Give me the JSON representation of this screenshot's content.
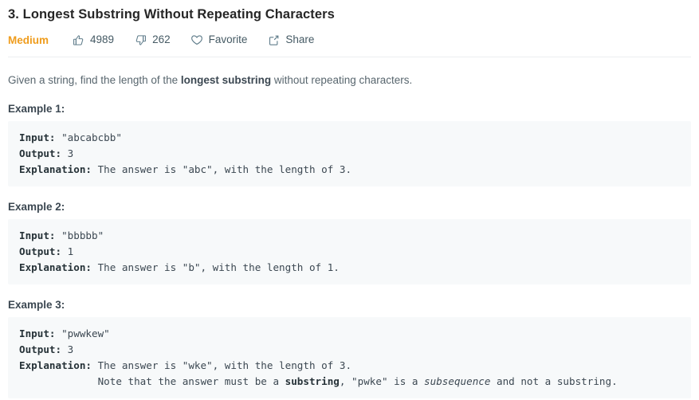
{
  "problem": {
    "title": "3. Longest Substring Without Repeating Characters",
    "difficulty": "Medium",
    "difficulty_color": "#ef9c1c"
  },
  "actions": [
    {
      "name": "likes",
      "icon": "thumbs-up-icon",
      "label": "4989"
    },
    {
      "name": "dislikes",
      "icon": "thumbs-down-icon",
      "label": "262"
    },
    {
      "name": "favorite",
      "icon": "heart-icon",
      "label": "Favorite"
    },
    {
      "name": "share",
      "icon": "share-icon",
      "label": "Share"
    }
  ],
  "description": {
    "lead": "Given a string, find the length of the ",
    "emphasis": "longest substring",
    "trail": " without repeating characters."
  },
  "examples": [
    {
      "heading": "Example 1:",
      "input_label": "Input:",
      "input_value": " \"abcabcbb\"",
      "output_label": "Output:",
      "output_value": " 3",
      "explanation_label": "Explanation:",
      "explanation_value": " The answer is \"abc\", with the length of 3."
    },
    {
      "heading": "Example 2:",
      "input_label": "Input:",
      "input_value": " \"bbbbb\"",
      "output_label": "Output:",
      "output_value": " 1",
      "explanation_label": "Explanation:",
      "explanation_value": " The answer is \"b\", with the length of 1."
    },
    {
      "heading": "Example 3:",
      "input_label": "Input:",
      "input_value": " \"pwwkew\"",
      "output_label": "Output:",
      "output_value": " 3",
      "explanation_label": "Explanation:",
      "explanation_value": " The answer is \"wke\", with the length of 3.",
      "note_indent": "             ",
      "note_part1": "Note that the answer must be a ",
      "note_bold": "substring",
      "note_part2": ", \"pwke\" is a ",
      "note_italic": "subsequence",
      "note_part3": " and not a substring."
    }
  ],
  "theme": {
    "code_background": "#f7f9fa",
    "divider": "#eceff1",
    "text": "#3c4852",
    "muted_text": "#58666e"
  }
}
